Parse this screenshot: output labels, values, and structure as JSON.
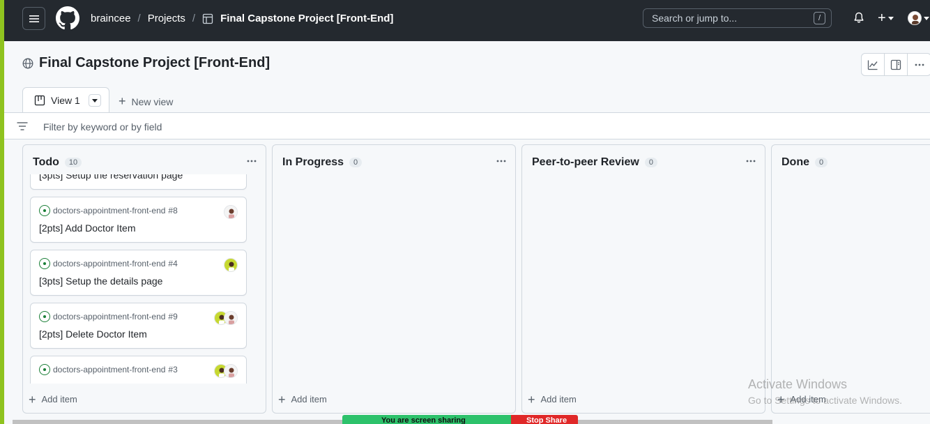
{
  "header": {
    "breadcrumbs": [
      "braincee",
      "Projects"
    ],
    "project_crumb": "Final Capstone Project [Front-End]",
    "search_placeholder": "Search or jump to...",
    "search_shortcut": "/"
  },
  "project": {
    "title": "Final Capstone Project [Front-End]",
    "views": [
      {
        "label": "View 1"
      }
    ],
    "new_view_label": "New view",
    "filter_placeholder": "Filter by keyword or by field"
  },
  "columns": [
    {
      "name": "Todo",
      "count": "10",
      "add_label": "Add item",
      "cards": [
        {
          "repo": "",
          "number": "",
          "title": "[3pts] Setup the reservation page"
        },
        {
          "repo": "doctors-appointment-front-end",
          "number": "#8",
          "title": "[2pts] Add Doctor Item"
        },
        {
          "repo": "doctors-appointment-front-end",
          "number": "#4",
          "title": "[3pts] Setup the details page"
        },
        {
          "repo": "doctors-appointment-front-end",
          "number": "#9",
          "title": "[2pts] Delete Doctor Item"
        },
        {
          "repo": "doctors-appointment-front-end",
          "number": "#3",
          "title": ""
        }
      ]
    },
    {
      "name": "In Progress",
      "count": "0",
      "add_label": "Add item",
      "cards": []
    },
    {
      "name": "Peer-to-peer Review",
      "count": "0",
      "add_label": "Add item",
      "cards": []
    },
    {
      "name": "Done",
      "count": "0",
      "add_label": "Add item",
      "cards": []
    }
  ],
  "overlays": {
    "screen_share_text": "You are screen sharing",
    "stop_share_label": "Stop Share",
    "watermark_title": "Activate Windows",
    "watermark_sub": "Go to Settings to activate Windows."
  },
  "colors": {
    "header_bg": "#24292f",
    "issue_open": "#1a7f37",
    "share_green": "#2dc26b",
    "stop_red": "#e02828",
    "edge_green": "#8fc31f"
  },
  "icons": [
    "hamburger-icon",
    "github-logo-icon",
    "table-icon",
    "bell-icon",
    "plus-icon",
    "globe-icon",
    "insights-icon",
    "panel-icon",
    "kebab-icon",
    "board-icon",
    "filter-icon",
    "issue-opened-icon"
  ]
}
